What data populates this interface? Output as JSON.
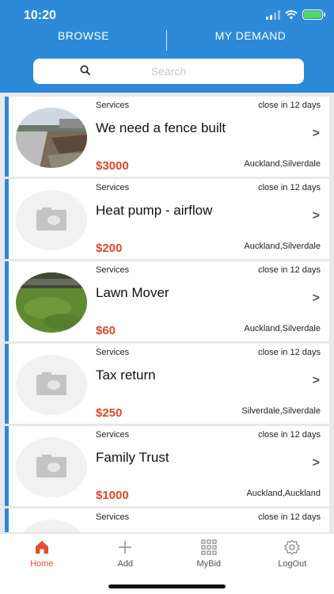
{
  "status_bar": {
    "time": "10:20"
  },
  "tabs": {
    "browse": "BROWSE",
    "my_demand": "MY DEMAND"
  },
  "search": {
    "placeholder": "Search"
  },
  "listings": [
    {
      "category": "Services",
      "close": "close in 12 days",
      "title": "We need a fence built",
      "price": "$3000",
      "location": "Auckland,Silverdale",
      "image": "fence-photo"
    },
    {
      "category": "Services",
      "close": "close in 12 days",
      "title": "Heat pump - airflow",
      "price": "$200",
      "location": "Auckland,Silverdale",
      "image": "placeholder-camera-icon"
    },
    {
      "category": "Services",
      "close": "close in 12 days",
      "title": "Lawn Mover",
      "price": "$60",
      "location": "Auckland,Silverdale",
      "image": "lawn-photo"
    },
    {
      "category": "Services",
      "close": "close in 12 days",
      "title": "Tax return",
      "price": "$250",
      "location": "Silverdale,Silverdale",
      "image": "placeholder-camera-icon"
    },
    {
      "category": "Services",
      "close": "close in 12 days",
      "title": "Family Trust",
      "price": "$1000",
      "location": "Auckland,Auckland",
      "image": "placeholder-camera-icon"
    },
    {
      "category": "Services",
      "close": "close in 12 days",
      "title": "",
      "price": "",
      "location": "",
      "image": "placeholder-camera-icon"
    }
  ],
  "chevron": ">",
  "nav": {
    "home": "Home",
    "add": "Add",
    "mybid": "MyBid",
    "logout": "LogOut"
  },
  "colors": {
    "header": "#2d8ad8",
    "price": "#d84a2b",
    "active_nav": "#e0502f"
  }
}
